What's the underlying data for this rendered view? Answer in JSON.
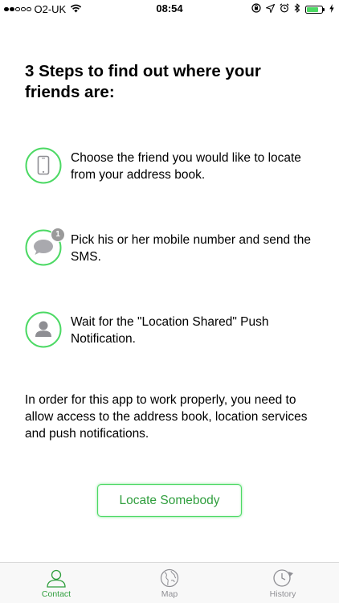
{
  "status_bar": {
    "carrier": "O2-UK",
    "time": "08:54",
    "signal_bars_filled": 2,
    "signal_bars_total": 5,
    "battery_level": 0.8
  },
  "title": "3 Steps to find out where your friends are:",
  "steps": [
    {
      "icon": "phone-icon",
      "text": "Choose the friend you would like to locate from your address book."
    },
    {
      "icon": "message-icon",
      "badge": "1",
      "text": "Pick his or her mobile number and send the SMS."
    },
    {
      "icon": "person-icon",
      "text": "Wait for the \"Location Shared\" Push Notification."
    }
  ],
  "info": "In order for this app to work properly, you need to allow access to the address book, location services and push notifications.",
  "button": {
    "label": "Locate Somebody"
  },
  "tabs": [
    {
      "label": "Contact",
      "icon": "contact-icon",
      "active": true
    },
    {
      "label": "Map",
      "icon": "globe-icon",
      "active": false
    },
    {
      "label": "History",
      "icon": "clock-icon",
      "active": false
    }
  ],
  "colors": {
    "accent": "#4cd964",
    "accent_text": "#2f9e3d",
    "icon_gray": "#8e8e93",
    "tab_inactive": "#8e8e93"
  }
}
